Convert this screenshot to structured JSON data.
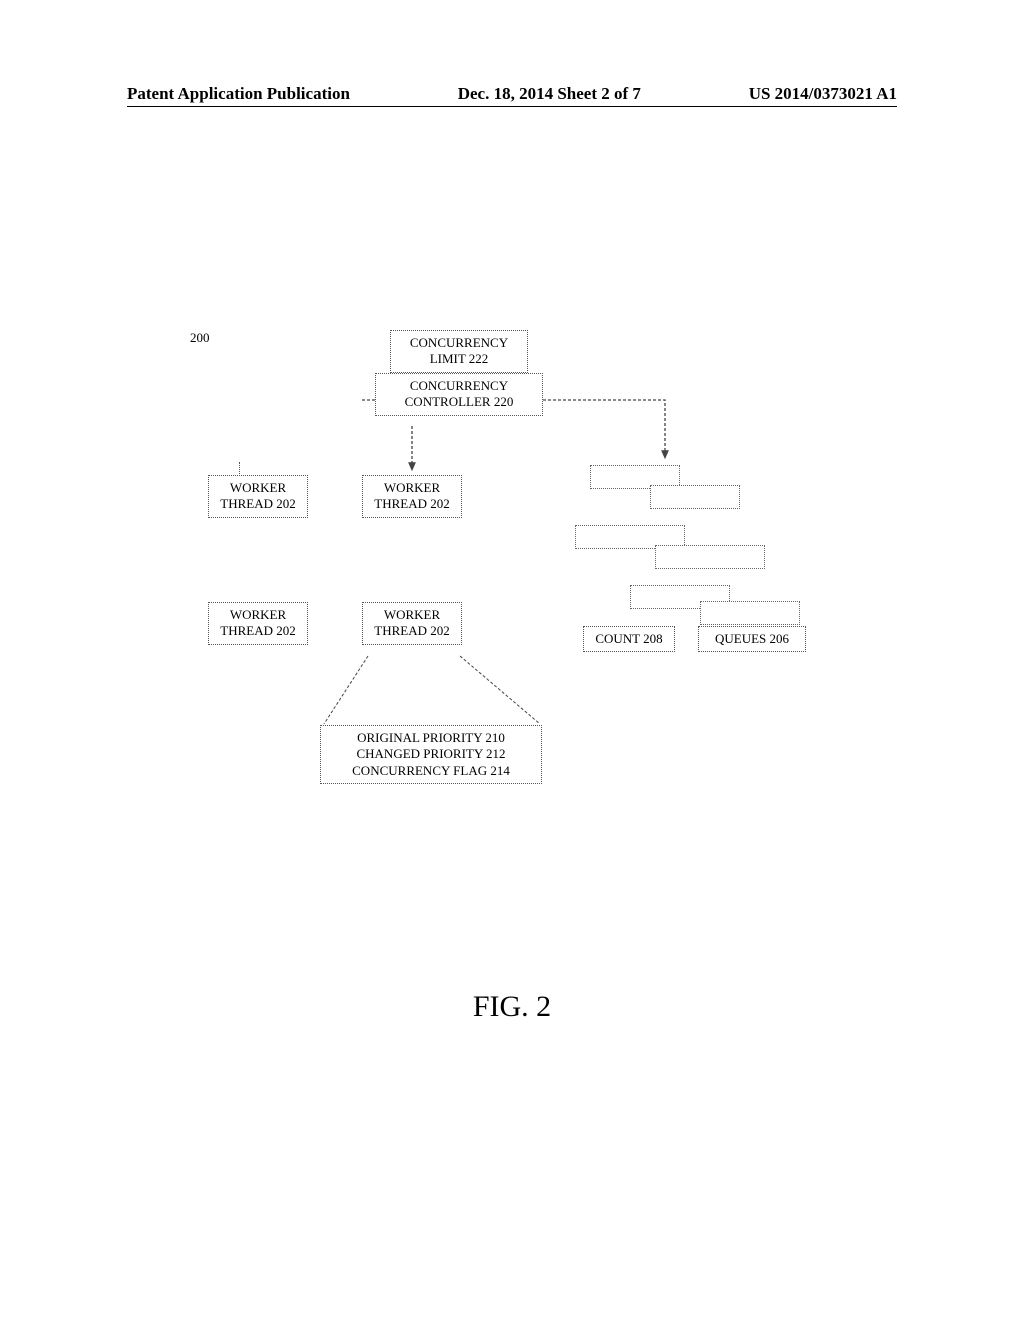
{
  "header": {
    "left": "Patent Application Publication",
    "center": "Dec. 18, 2014  Sheet 2 of 7",
    "right": "US 2014/0373021 A1"
  },
  "diagram": {
    "ref_label": "200",
    "concurrency_limit": "CONCURRENCY LIMIT 222",
    "concurrency_controller": "CONCURRENCY CONTROLLER 220",
    "worker_thread": "WORKER THREAD 202",
    "count": "COUNT 208",
    "queues": "QUEUES 206",
    "detail_line1": "ORIGINAL PRIORITY 210",
    "detail_line2": "CHANGED PRIORITY 212",
    "detail_line3": "CONCURRENCY FLAG 214"
  },
  "figure_caption": "FIG. 2"
}
